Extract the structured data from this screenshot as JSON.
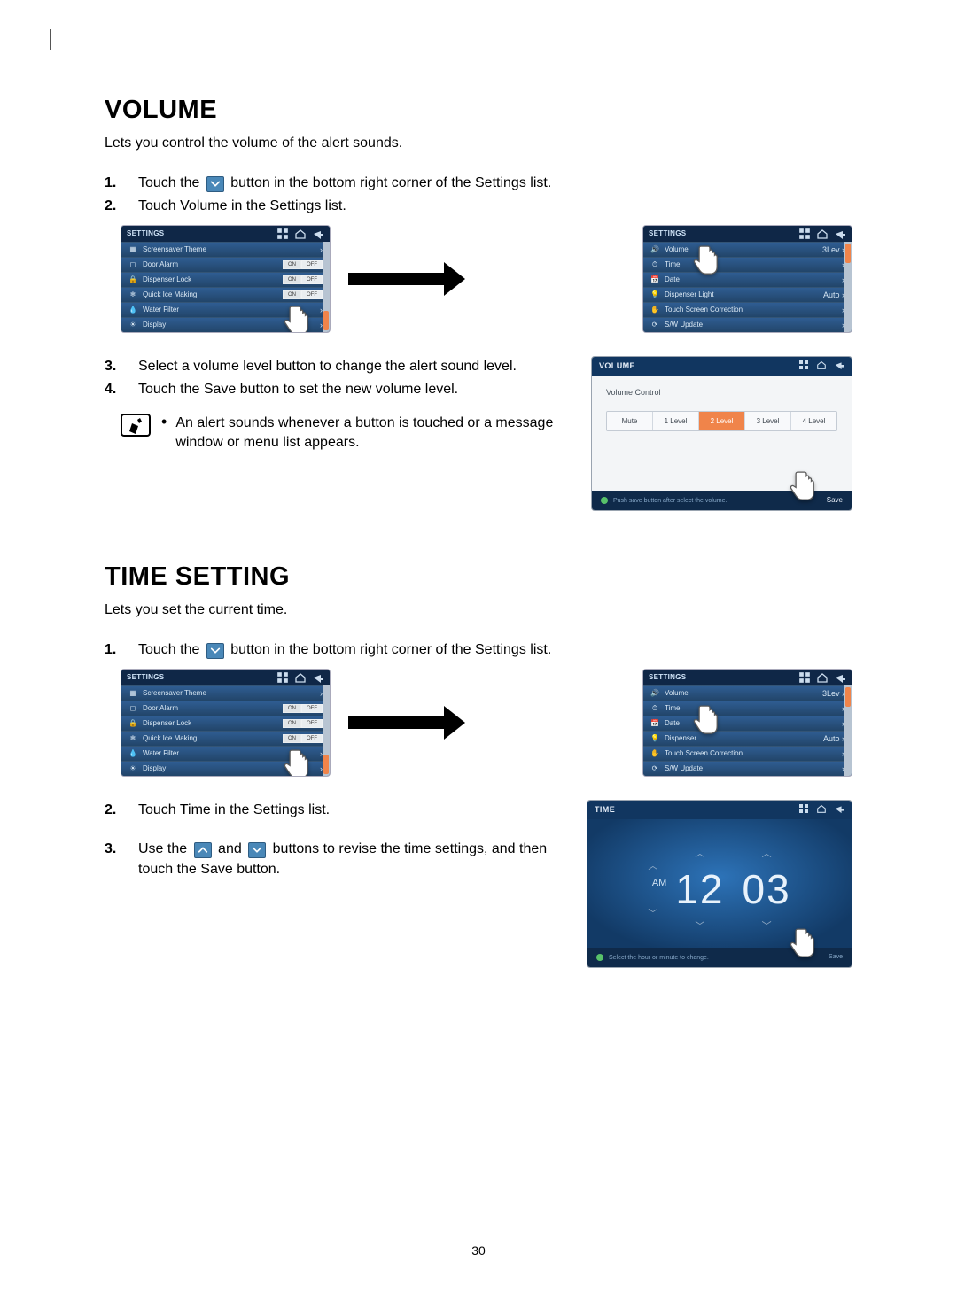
{
  "page_number": "30",
  "volume": {
    "title": "VOLUME",
    "subtitle": "Lets you control the volume of the alert sounds.",
    "steps": {
      "s1a": "Touch the ",
      "s1b": " button in the bottom right corner of the Settings list.",
      "s2": "Touch Volume in the Settings list.",
      "s3": "Select a volume level button to change the alert sound level.",
      "s4": "Touch the Save button to set the new volume level."
    },
    "note": "An alert sounds whenever a button is touched or a message window or menu list appears.",
    "panelA": {
      "header": "SETTINGS",
      "items": [
        "Screensaver Theme",
        "Door Alarm",
        "Dispenser Lock",
        "Quick Ice Making",
        "Water Filter",
        "Display"
      ],
      "toggles": {
        "on": "ON",
        "off": "OFF"
      }
    },
    "panelB": {
      "header": "SETTINGS",
      "items": [
        "Volume",
        "Time",
        "Date",
        "Dispenser Light",
        "Touch Screen Correction",
        "S/W Update"
      ],
      "right0": "3Lev",
      "rightAuto": "Auto"
    },
    "volPanel": {
      "header": "VOLUME",
      "label": "Volume Control",
      "options": [
        "Mute",
        "1 Level",
        "2 Level",
        "3 Level",
        "4 Level"
      ],
      "selectedIndex": 2,
      "hint": "Push save button after select the volume.",
      "save": "Save"
    }
  },
  "time": {
    "title": "TIME SETTING",
    "subtitle": "Lets you set the current time.",
    "steps": {
      "s1a": "Touch the ",
      "s1b": " button in the bottom right corner of the Settings list.",
      "s2": "Touch Time in the Settings list.",
      "s3a": "Use the ",
      "s3b": " and ",
      "s3c": " buttons to revise the time settings, and then touch the Save button."
    },
    "panelA": {
      "header": "SETTINGS",
      "items": [
        "Screensaver Theme",
        "Door Alarm",
        "Dispenser Lock",
        "Quick Ice Making",
        "Water Filter",
        "Display"
      ],
      "toggles": {
        "on": "ON",
        "off": "OFF"
      }
    },
    "panelB": {
      "header": "SETTINGS",
      "items": [
        "Volume",
        "Time",
        "Date",
        "Dispenser",
        "Touch Screen Correction",
        "S/W Update"
      ],
      "right0": "3Lev",
      "rightAuto": "Auto"
    },
    "timePanel": {
      "header": "TIME",
      "ampm": "AM",
      "hour": "12",
      "minute": "03",
      "hint": "Select the hour or minute to change.",
      "save": "Save"
    }
  }
}
